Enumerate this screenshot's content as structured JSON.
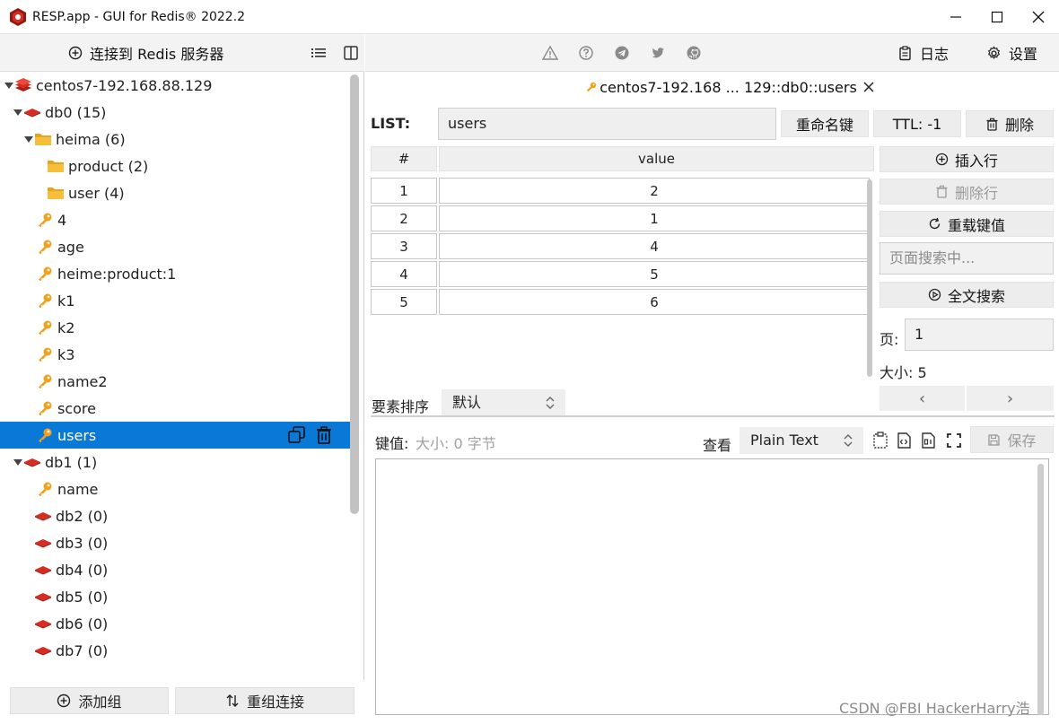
{
  "window": {
    "title": "RESP.app - GUI for Redis® 2022.2",
    "minimize": "—",
    "maximize": "☐",
    "close": "✕"
  },
  "left_toolbar": {
    "connect_label": "连接到 Redis 服务器"
  },
  "tree": {
    "items": [
      {
        "label": "centos7-192.168.88.129",
        "kind": "server",
        "expanded": true,
        "indent": 0
      },
      {
        "label": "db0  (15)",
        "kind": "db",
        "expanded": true,
        "indent": 1
      },
      {
        "label": "heima (6)",
        "kind": "folder",
        "expanded": true,
        "indent": 2
      },
      {
        "label": "product (2)",
        "kind": "folder",
        "expanded": false,
        "indent": 3
      },
      {
        "label": "user (4)",
        "kind": "folder",
        "expanded": false,
        "indent": 3
      },
      {
        "label": "4",
        "kind": "key",
        "indent": 3
      },
      {
        "label": "age",
        "kind": "key",
        "indent": 3
      },
      {
        "label": "heime:product:1",
        "kind": "key",
        "indent": 3
      },
      {
        "label": "k1",
        "kind": "key",
        "indent": 3
      },
      {
        "label": "k2",
        "kind": "key",
        "indent": 3
      },
      {
        "label": "k3",
        "kind": "key",
        "indent": 3
      },
      {
        "label": "name2",
        "kind": "key",
        "indent": 3
      },
      {
        "label": "score",
        "kind": "key",
        "indent": 3
      },
      {
        "label": "users",
        "kind": "key",
        "indent": 3,
        "selected": true
      },
      {
        "label": "db1  (1)",
        "kind": "db",
        "expanded": true,
        "indent": 1
      },
      {
        "label": "name",
        "kind": "key",
        "indent": 3
      },
      {
        "label": "db2  (0)",
        "kind": "db",
        "indent": 2
      },
      {
        "label": "db3  (0)",
        "kind": "db",
        "indent": 2
      },
      {
        "label": "db4  (0)",
        "kind": "db",
        "indent": 2
      },
      {
        "label": "db5  (0)",
        "kind": "db",
        "indent": 2
      },
      {
        "label": "db6  (0)",
        "kind": "db",
        "indent": 2
      },
      {
        "label": "db7  (0)",
        "kind": "db",
        "indent": 2
      }
    ]
  },
  "left_bottom": {
    "add_group": "添加组",
    "regroup": "重组连接"
  },
  "right_toolbar": {
    "log_label": "日志",
    "settings_label": "设置"
  },
  "tab": {
    "title": "centos7-192.168 ... 129::db0::users"
  },
  "key_editor": {
    "type_label": "LIST:",
    "key_name": "users",
    "rename_label": "重命名键",
    "ttl_label": "TTL:  -1",
    "delete_label": "删除",
    "columns": [
      "#",
      "value"
    ],
    "rows": [
      {
        "index": "1",
        "value": "2"
      },
      {
        "index": "2",
        "value": "1"
      },
      {
        "index": "3",
        "value": "4"
      },
      {
        "index": "4",
        "value": "5"
      },
      {
        "index": "5",
        "value": "6"
      }
    ],
    "insert_row": "插入行",
    "delete_row": "删除行",
    "reload": "重载键值",
    "page_search_placeholder": "页面搜索中...",
    "full_search": "全文搜索",
    "page_label": "页:",
    "page_value": "1",
    "size_label": "大小:  5",
    "prev": "‹",
    "next": "›",
    "sort_label": "要素排序",
    "sort_value": "默认"
  },
  "value_view": {
    "label": "键值:",
    "meta": "大小:  0 字节",
    "view_label": "查看",
    "format_value": "Plain Text",
    "save_label": "保存"
  },
  "watermark": "CSDN @FBI HackerHarry浩",
  "colors": {
    "selection": "#0a78d7",
    "redis_red": "#d82c20",
    "key_orange": "#f0a11e",
    "folder_yellow": "#f5b625"
  }
}
